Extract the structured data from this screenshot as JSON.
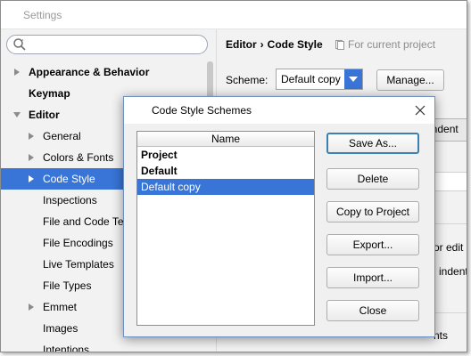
{
  "settings": {
    "title": "Settings",
    "search": {
      "value": "",
      "placeholder": ""
    },
    "tree": [
      {
        "label": "Appearance & Behavior",
        "bold": true,
        "arrow": "right",
        "level": 0
      },
      {
        "label": "Keymap",
        "bold": true,
        "arrow": "",
        "level": 0
      },
      {
        "label": "Editor",
        "bold": true,
        "arrow": "down",
        "level": 0
      },
      {
        "label": "General",
        "bold": false,
        "arrow": "right",
        "level": 1
      },
      {
        "label": "Colors & Fonts",
        "bold": false,
        "arrow": "right",
        "level": 1
      },
      {
        "label": "Code Style",
        "bold": false,
        "arrow": "right",
        "level": 1,
        "selected": true
      },
      {
        "label": "Inspections",
        "bold": false,
        "arrow": "",
        "level": 1
      },
      {
        "label": "File and Code Ter",
        "bold": false,
        "arrow": "",
        "level": 1
      },
      {
        "label": "File Encodings",
        "bold": false,
        "arrow": "",
        "level": 1
      },
      {
        "label": "Live Templates",
        "bold": false,
        "arrow": "",
        "level": 1
      },
      {
        "label": "File Types",
        "bold": false,
        "arrow": "",
        "level": 1
      },
      {
        "label": "Emmet",
        "bold": false,
        "arrow": "right",
        "level": 1
      },
      {
        "label": "Images",
        "bold": false,
        "arrow": "",
        "level": 1
      },
      {
        "label": "Intentions",
        "bold": false,
        "arrow": "",
        "level": 1
      }
    ]
  },
  "right_pane": {
    "breadcrumb": {
      "first": "Editor",
      "separator": "›",
      "second": "Code Style"
    },
    "project_note": "For current project",
    "scheme_label": "Scheme:",
    "scheme_value": "Default copy",
    "manage_label": "Manage...",
    "tab_fragment": "endent",
    "frag_1": "or edit",
    "frag_2": "l indent",
    "frag_3": "nts"
  },
  "dialog": {
    "title": "Code Style Schemes",
    "column_header": "Name",
    "schemes": [
      {
        "name": "Project",
        "bold": true
      },
      {
        "name": "Default",
        "bold": true
      },
      {
        "name": "Default copy",
        "bold": false,
        "selected": true
      }
    ],
    "buttons": {
      "save_as": "Save As...",
      "delete": "Delete",
      "copy_to_project": "Copy to Project",
      "export": "Export...",
      "import": "Import...",
      "close": "Close"
    }
  },
  "colors": {
    "selection": "#3875d7",
    "focus_border": "#3c7fb1"
  }
}
